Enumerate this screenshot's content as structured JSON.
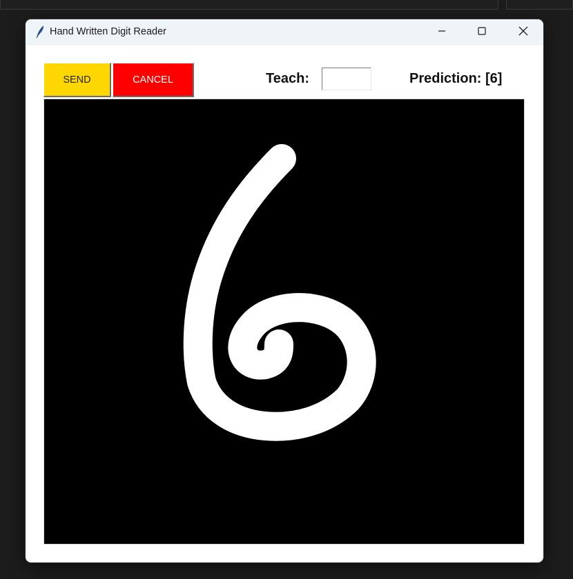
{
  "window": {
    "title": "Hand Written Digit Reader",
    "app_icon": "feather-icon",
    "controls": {
      "minimize_icon": "minimize-icon",
      "maximize_icon": "maximize-icon",
      "close_icon": "close-icon"
    }
  },
  "toolbar": {
    "send_label": "SEND",
    "cancel_label": "CANCEL",
    "teach_label": "Teach:",
    "teach_value": "",
    "prediction_text": "Prediction: [6]"
  },
  "drawing_canvas": {
    "background_color": "#000000",
    "stroke_color": "#ffffff",
    "drawn_digit": "6"
  },
  "colors": {
    "send_button": "#ffd700",
    "cancel_button": "#ff0000",
    "titlebar": "#eff4f9",
    "desktop": "#1c1c1c"
  }
}
